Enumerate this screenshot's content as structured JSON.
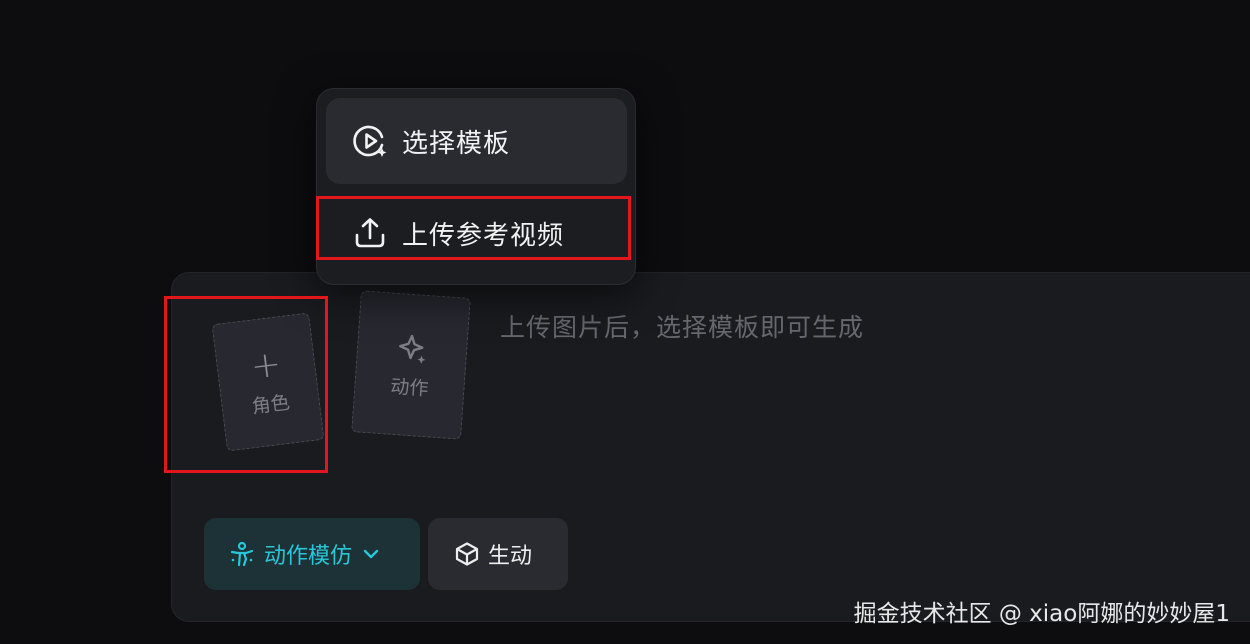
{
  "menu": {
    "items": [
      {
        "label": "选择模板",
        "icon": "template-play-icon",
        "active": true
      },
      {
        "label": "上传参考视频",
        "icon": "upload-icon",
        "active": false
      }
    ]
  },
  "cards": {
    "character": {
      "label": "角色",
      "icon": "plus-icon"
    },
    "motion": {
      "label": "动作",
      "icon": "sparkle-icon"
    }
  },
  "prompt": {
    "placeholder": "上传图片后，选择模板即可生成"
  },
  "chips": {
    "mode": {
      "label": "动作模仿",
      "icon": "person-motion-icon",
      "caret_icon": "chevron-down-icon"
    },
    "style": {
      "label": "生动",
      "icon": "cube-icon"
    }
  },
  "watermark": "掘金技术社区 @ xiao阿娜的妙妙屋1",
  "colors": {
    "accent": "#27c6d9",
    "highlight": "#e3161b",
    "background": "#0d0d10",
    "panel": "#1a1b1f"
  }
}
